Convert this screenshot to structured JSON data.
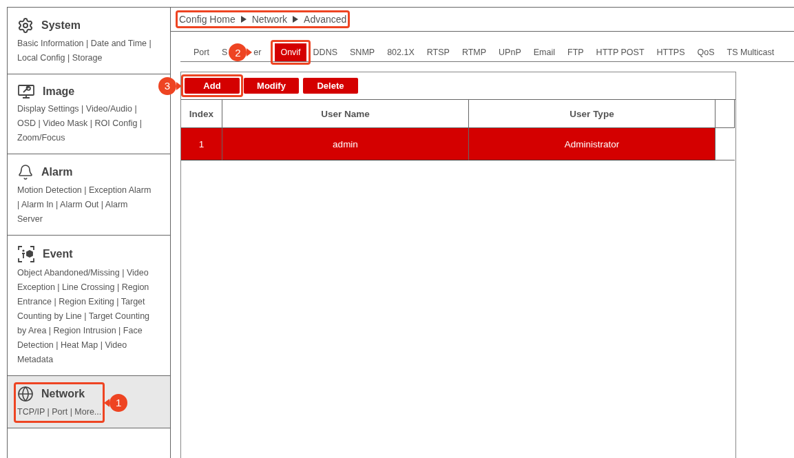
{
  "sidebar": {
    "sections": [
      {
        "title": "System",
        "links": "Basic Information | Date and Time | Local Config | Storage",
        "selected": false
      },
      {
        "title": "Image",
        "links": "Display Settings | Video/Audio | OSD | Video Mask | ROI Config | Zoom/Focus",
        "selected": false
      },
      {
        "title": "Alarm",
        "links": "Motion Detection | Exception Alarm | Alarm In | Alarm Out | Alarm Server",
        "selected": false
      },
      {
        "title": "Event",
        "links": "Object Abandoned/Missing | Video Exception | Line Crossing | Region Entrance | Region Exiting | Target Counting by Line | Target Counting by Area | Region Intrusion | Face Detection | Heat Map | Video Metadata",
        "selected": false
      },
      {
        "title": "Network",
        "links": "TCP/IP | Port | More...",
        "selected": true,
        "annotation": "1"
      }
    ]
  },
  "breadcrumb": {
    "items": [
      "Config Home",
      "Network",
      "Advanced"
    ],
    "highlighted": true
  },
  "tabs": [
    {
      "label": "Port",
      "selected": false
    },
    {
      "label_parts": [
        "S",
        "er"
      ],
      "selected": false
    },
    {
      "label": "Onvif",
      "selected": true,
      "annotation": "2"
    },
    {
      "label": "DDNS",
      "selected": false
    },
    {
      "label": "SNMP",
      "selected": false
    },
    {
      "label": "802.1X",
      "selected": false
    },
    {
      "label": "RTSP",
      "selected": false
    },
    {
      "label": "RTMP",
      "selected": false
    },
    {
      "label": "UPnP",
      "selected": false
    },
    {
      "label": "Email",
      "selected": false
    },
    {
      "label": "FTP",
      "selected": false
    },
    {
      "label": "HTTP POST",
      "selected": false
    },
    {
      "label": "HTTPS",
      "selected": false
    },
    {
      "label": "QoS",
      "selected": false
    },
    {
      "label": "TS Multicast",
      "selected": false
    }
  ],
  "buttons": [
    {
      "label": "Add",
      "annotation": "3"
    },
    {
      "label": "Modify"
    },
    {
      "label": "Delete"
    }
  ],
  "table": {
    "columns": [
      "Index",
      "User Name",
      "User Type"
    ],
    "rows": [
      {
        "cells": [
          "1",
          "admin",
          "Administrator"
        ],
        "selected": true
      }
    ]
  }
}
